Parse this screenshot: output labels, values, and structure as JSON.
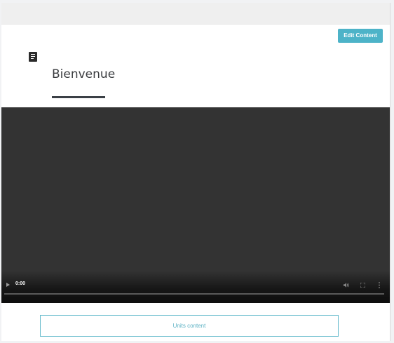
{
  "header": {
    "edit_button_label": "Edit Content"
  },
  "lesson": {
    "icon": "document-lines-icon",
    "title": "Bienvenue"
  },
  "video": {
    "current_time": "0:00",
    "progress": 0,
    "controls": [
      "play-icon",
      "volume-icon",
      "fullscreen-icon",
      "more-options-icon"
    ]
  },
  "footer": {
    "units_button_label": "Units content"
  },
  "colors": {
    "accent": "#4db3c8",
    "units_border": "#69bccd",
    "title_text": "#3b3d40",
    "video_background": "#333333"
  }
}
